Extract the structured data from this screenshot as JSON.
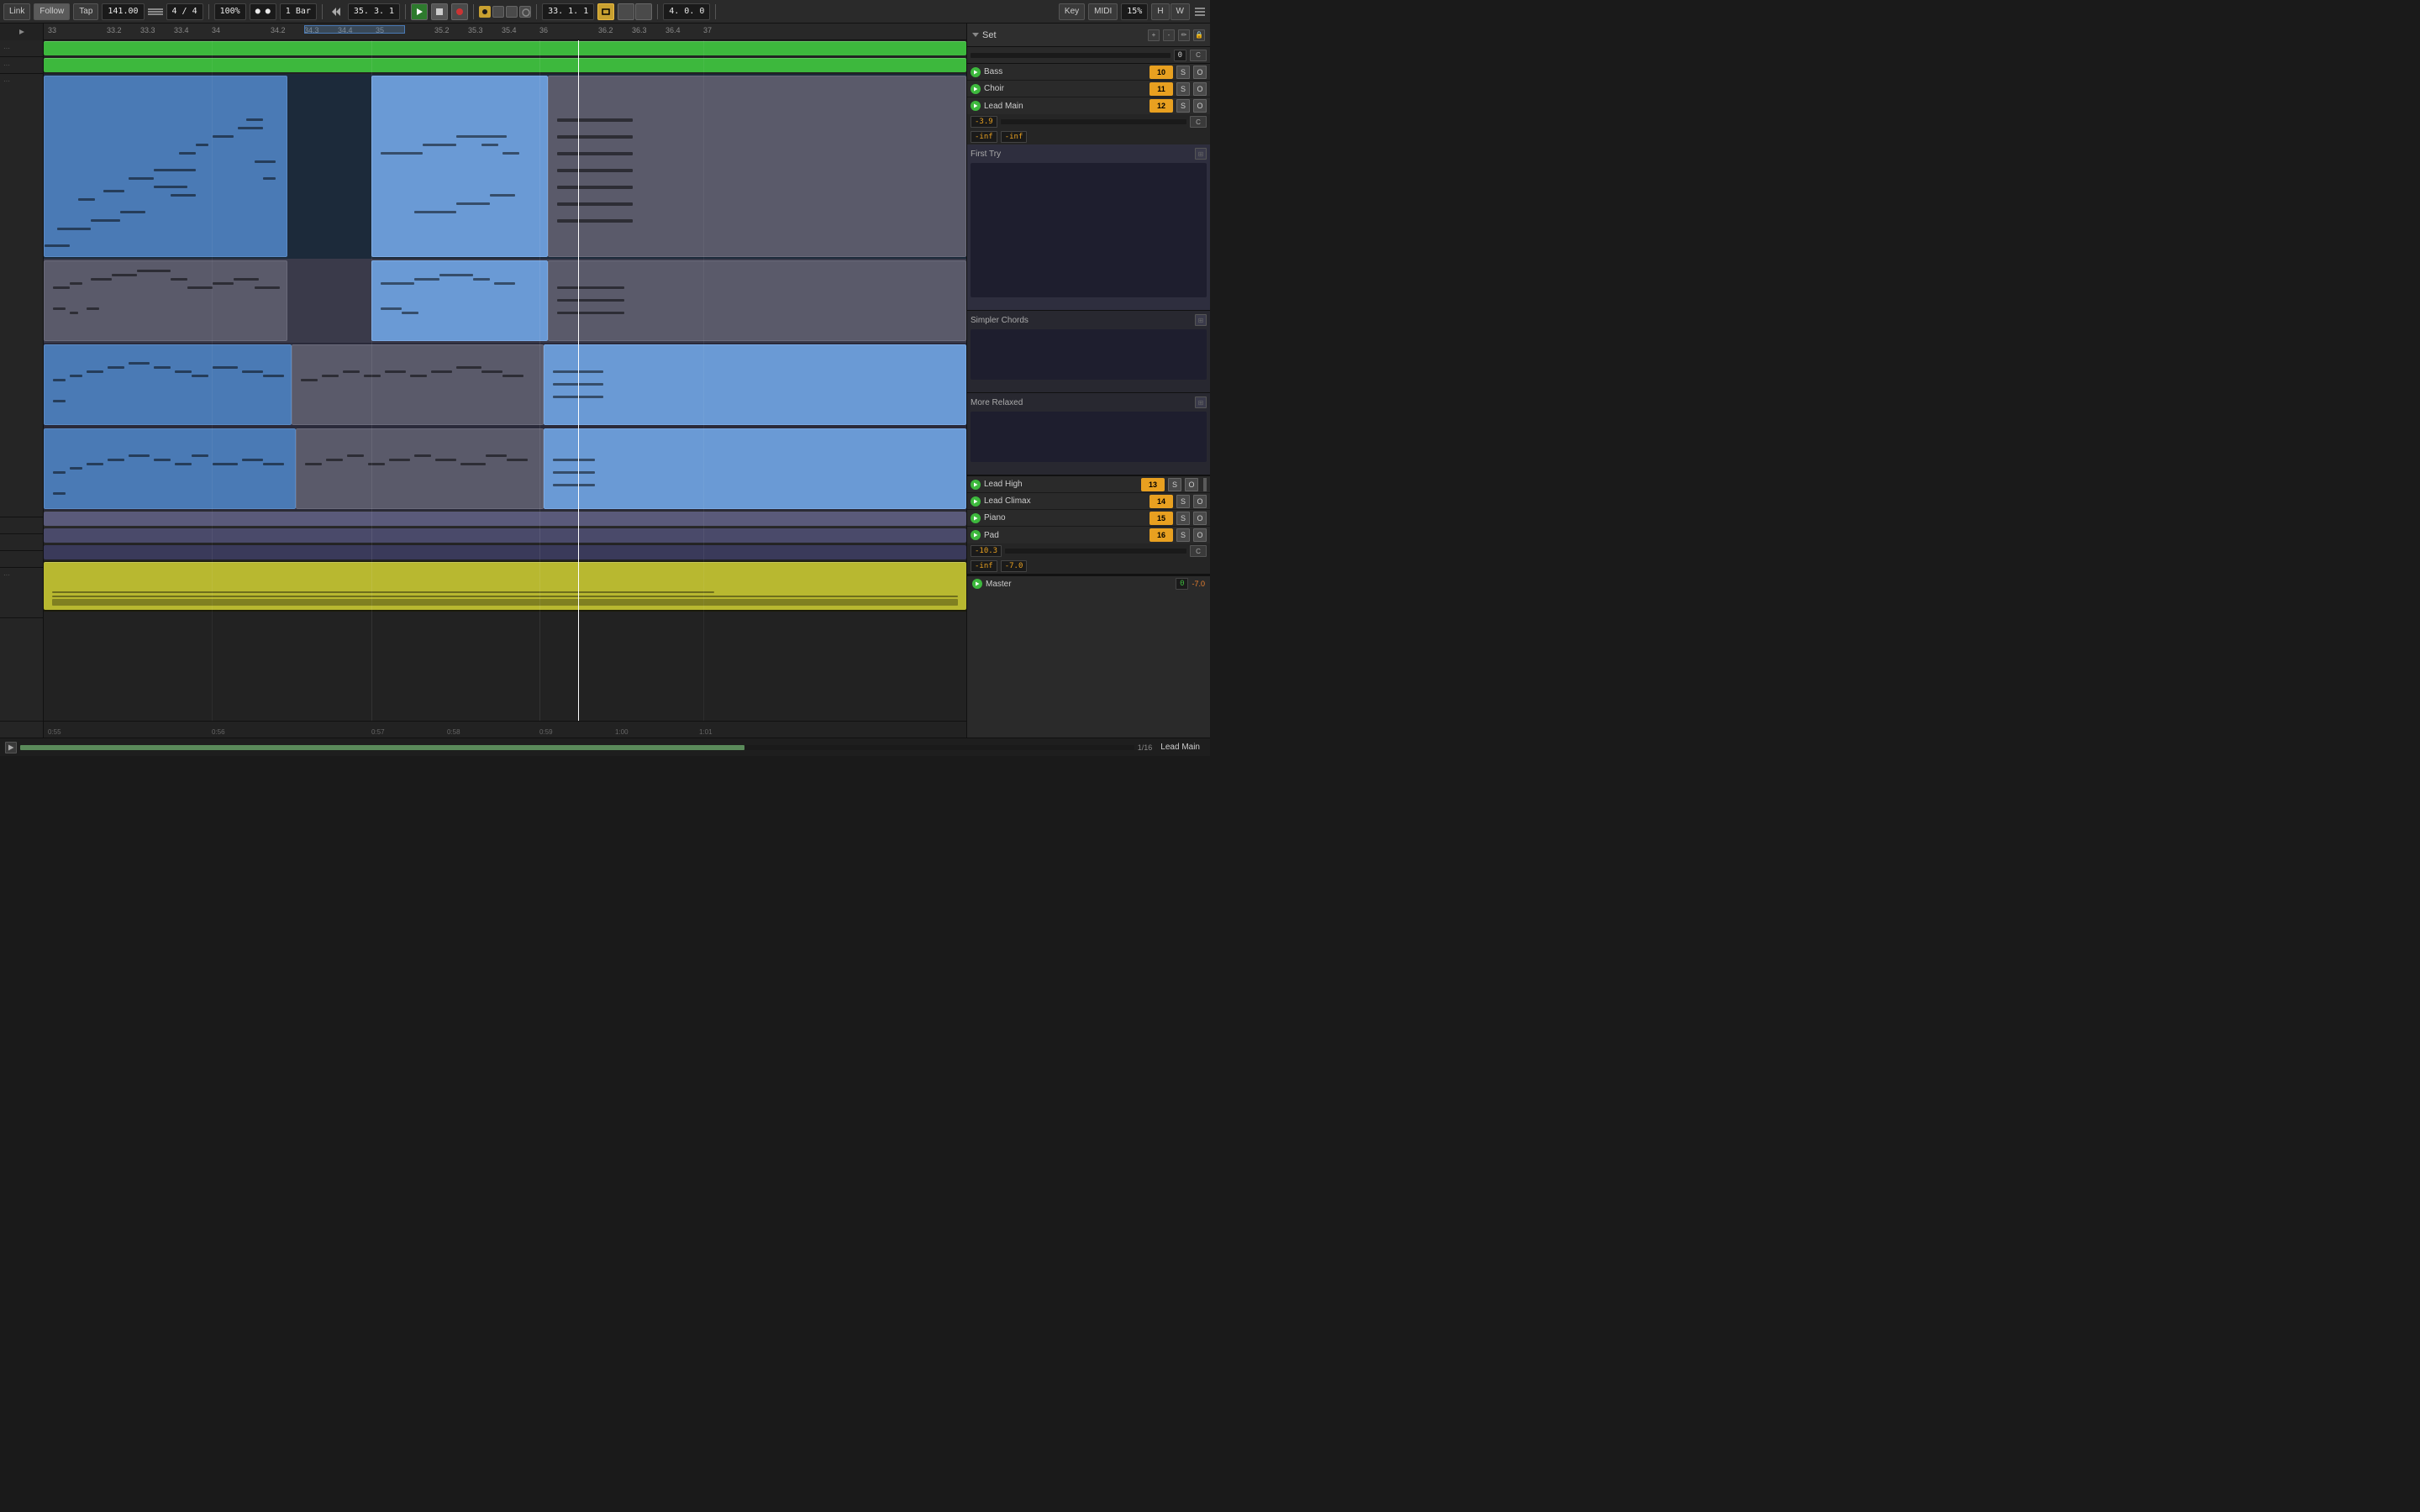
{
  "toolbar": {
    "link": "Link",
    "follow": "Follow",
    "tap": "Tap",
    "bpm": "141.00",
    "time_sig": "4 / 4",
    "zoom": "100%",
    "quantize": "1 Bar",
    "position": "35. 3. 1",
    "song_position": "33. 1. 1",
    "loop_end": "4. 0. 0",
    "key": "Key",
    "midi": "MIDI",
    "scale_pct": "15%",
    "hw": "H",
    "wh": "W"
  },
  "timeline": {
    "marks": [
      "33",
      "33.2",
      "33.3",
      "33.4",
      "34",
      "34.2",
      "34.3",
      "34.4",
      "35",
      "35.2",
      "35.3",
      "35.4",
      "36",
      "36.2",
      "36.3",
      "36.4",
      "37"
    ]
  },
  "tracks": [
    {
      "name": "Bass",
      "num": "10",
      "type": "green",
      "s": "S",
      "o": "O"
    },
    {
      "name": "Choir",
      "num": "11",
      "type": "green",
      "s": "S",
      "o": "O"
    },
    {
      "name": "Lead Main",
      "num": "12",
      "type": "blue",
      "vol": "-3.9",
      "inf1": "-inf",
      "inf2": "-inf",
      "s": "S",
      "o": "O"
    },
    {
      "name": "Lead High",
      "num": "13",
      "type": "orange",
      "s": "S",
      "o": "O"
    },
    {
      "name": "Lead Climax",
      "num": "14",
      "type": "orange",
      "s": "S",
      "o": "O"
    },
    {
      "name": "Piano",
      "num": "15",
      "type": "orange",
      "s": "S",
      "o": "O"
    },
    {
      "name": "Pad",
      "num": "16",
      "type": "orange",
      "vol": "-10.3",
      "inf1": "-inf",
      "inf2": "-7.0",
      "s": "S",
      "o": "O"
    }
  ],
  "clip_groups": [
    {
      "name": "First Try"
    },
    {
      "name": "Simpler Chords"
    },
    {
      "name": "More Relaxed"
    }
  ],
  "set_label": "Set",
  "master_label": "Master",
  "bottom_label": "Lead Main",
  "page_fraction": "1/16",
  "neg_inf": "-inf",
  "time_marks": [
    "0:55",
    "0:56",
    "0:57",
    "0:58",
    "0:59",
    "1:00",
    "1:01"
  ]
}
